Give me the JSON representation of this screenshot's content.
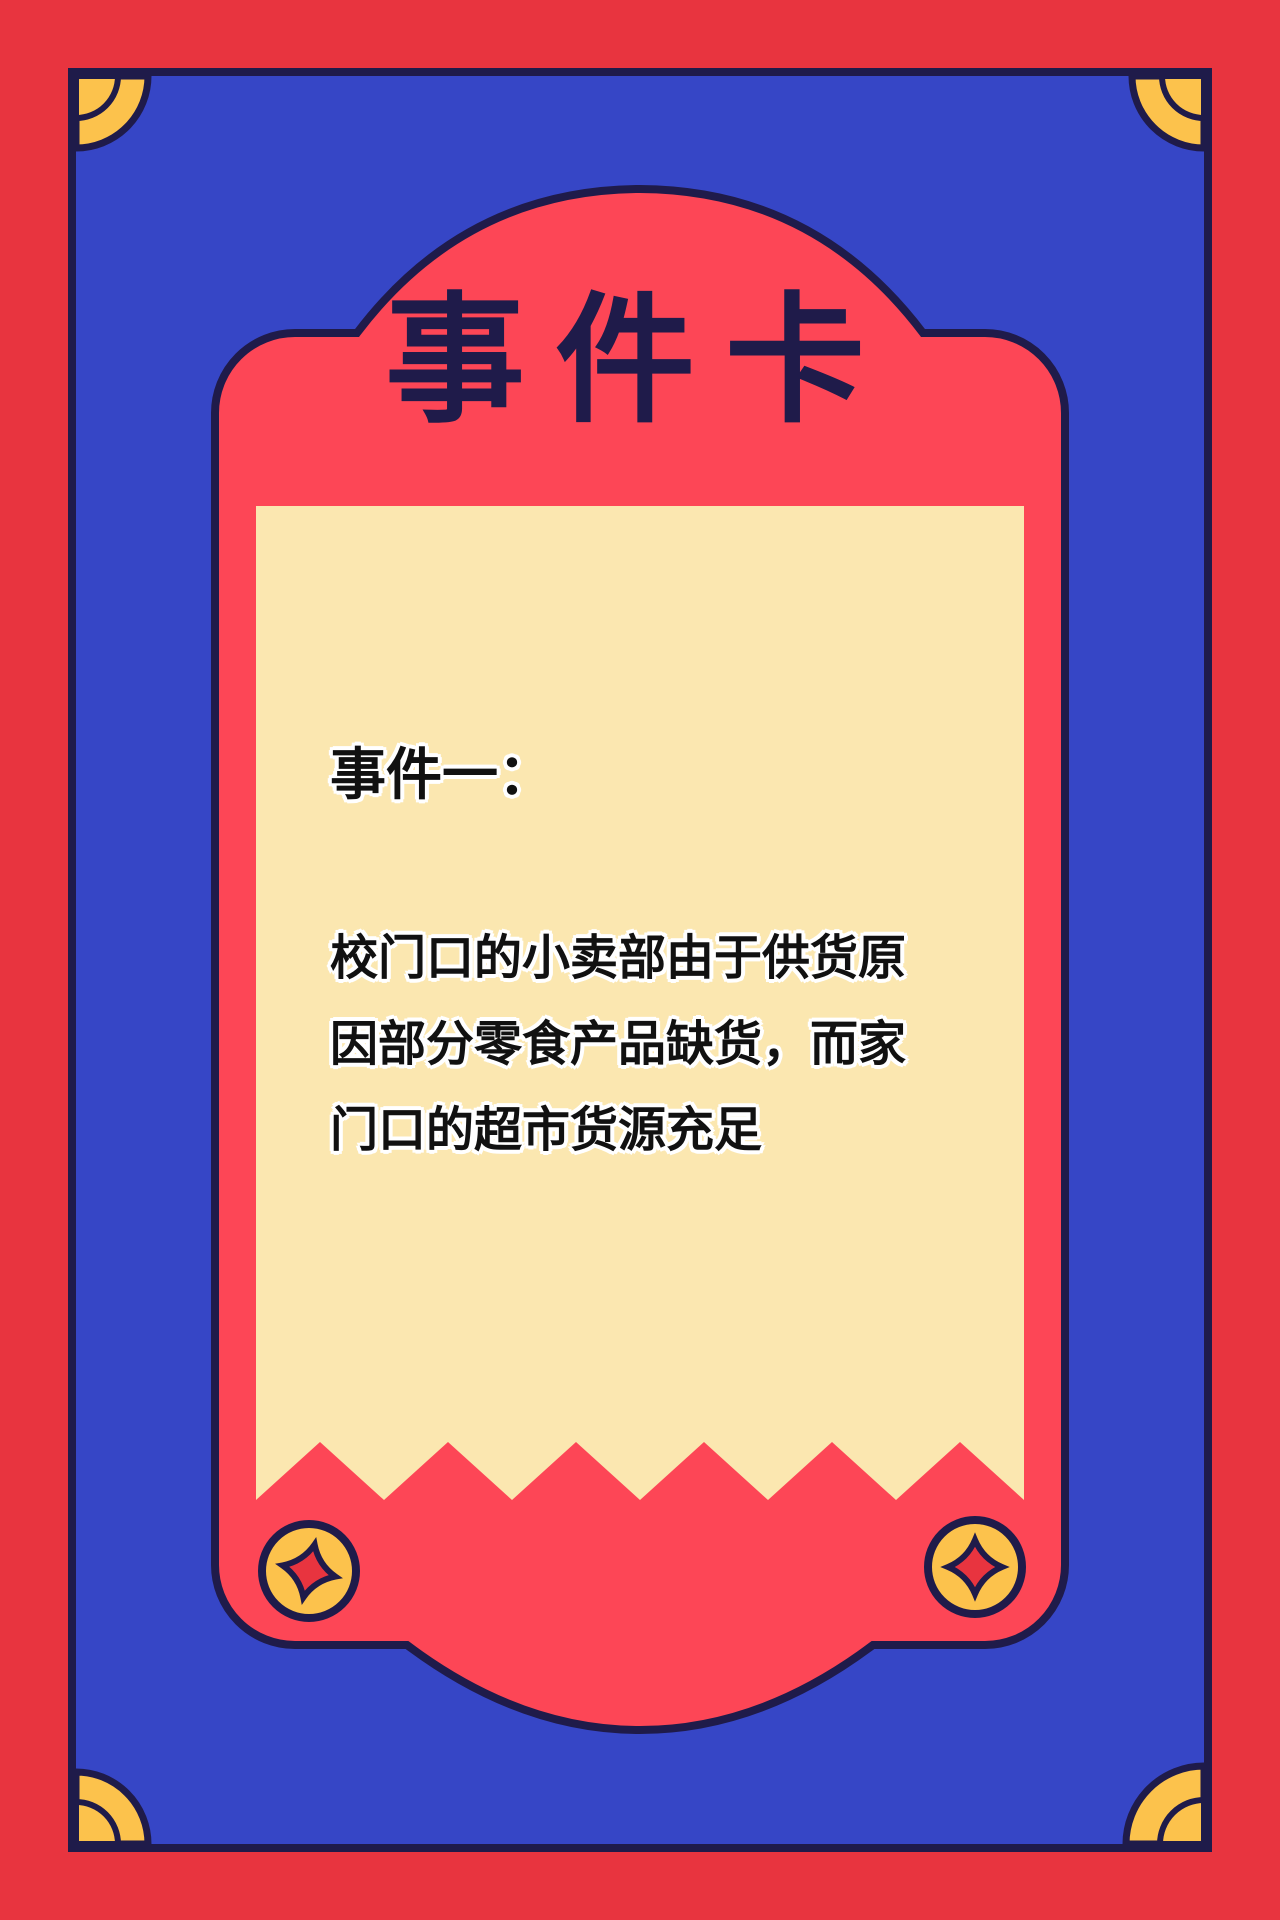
{
  "card": {
    "title": "事件卡",
    "event_heading": "事件一：",
    "event_lines": [
      "校门口的小卖部由于供货原",
      "因部分零食产品缺货，而家",
      "门口的超市货源充足"
    ]
  },
  "colors": {
    "outer_red": "#e8343f",
    "panel_blue": "#3646c6",
    "card_coral": "#fd4656",
    "paper_cream": "#fbe7b0",
    "corner_gold": "#fcc24c",
    "outline_navy": "#1f1b4a"
  },
  "decorations": [
    "corner-arc-icon",
    "coin-icon"
  ]
}
